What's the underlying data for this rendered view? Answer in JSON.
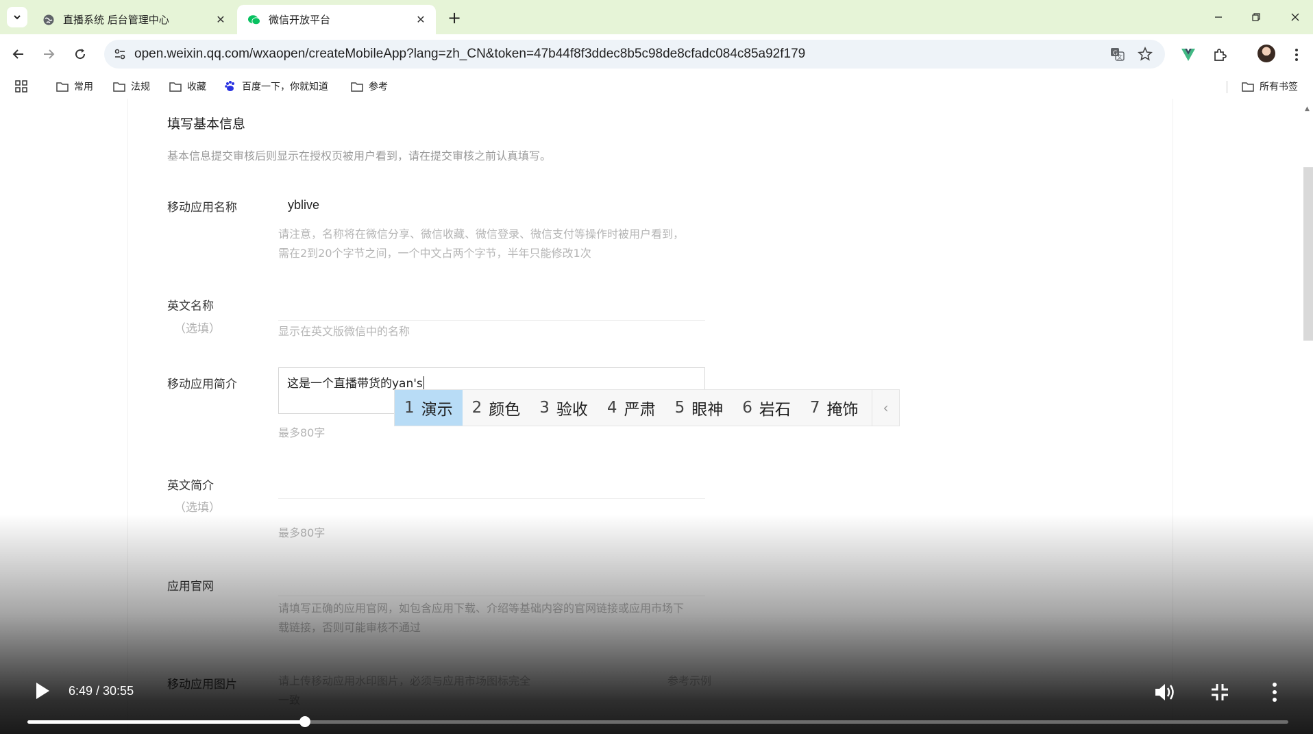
{
  "browser": {
    "tabs": [
      {
        "title": "直播系统 后台管理中心",
        "favicon": "globe-icon"
      },
      {
        "title": "微信开放平台",
        "favicon": "wechat-icon",
        "active": true
      }
    ],
    "url": "open.weixin.qq.com/wxaopen/createMobileApp?lang=zh_CN&token=47b44f8f3ddec8b5c98de8cfadc084c85a92f179",
    "bookmarks": [
      {
        "label": "常用",
        "icon": "folder-icon"
      },
      {
        "label": "法规",
        "icon": "folder-icon"
      },
      {
        "label": "收藏",
        "icon": "folder-icon"
      },
      {
        "label": "百度一下，你就知道",
        "icon": "baidu-paw-icon"
      },
      {
        "label": "参考",
        "icon": "folder-icon"
      }
    ],
    "all_bookmarks": "所有书签"
  },
  "form": {
    "section_title": "填写基本信息",
    "section_desc": "基本信息提交审核后则显示在授权页被用户看到，请在提交审核之前认真填写。",
    "app_name": {
      "label": "移动应用名称",
      "value": "yblive",
      "tip_line1": "请注意，名称将在微信分享、微信收藏、微信登录、微信支付等操作时被用户看到，",
      "tip_line2": "需在2到20个字节之间，一个中文占两个字节，半年只能修改1次"
    },
    "english_name": {
      "label": "英文名称",
      "optional": "（选填）",
      "tip": "显示在英文版微信中的名称"
    },
    "app_intro": {
      "label": "移动应用简介",
      "value": "这是一个直播带货的yan's",
      "tip": "最多80字"
    },
    "english_intro": {
      "label": "英文简介",
      "optional": "（选填）",
      "tip": "最多80字"
    },
    "website": {
      "label": "应用官网",
      "tip_line1": "请填写正确的应用官网，如包含应用下载、介绍等基础内容的官网链接或应用市场下",
      "tip_line2": "载链接，否则可能审核不通过"
    },
    "app_image": {
      "label": "移动应用图片",
      "tip_line1": "请上传移动应用水印图片，必须与应用市场图标完全",
      "tip_line2": "一致",
      "example": "参考示例"
    }
  },
  "ime": {
    "candidates": [
      {
        "num": "1",
        "text": "演示",
        "selected": true
      },
      {
        "num": "2",
        "text": "颜色"
      },
      {
        "num": "3",
        "text": "验收"
      },
      {
        "num": "4",
        "text": "严肃"
      },
      {
        "num": "5",
        "text": "眼神"
      },
      {
        "num": "6",
        "text": "岩石"
      },
      {
        "num": "7",
        "text": "掩饰"
      }
    ]
  },
  "player": {
    "current_time": "6:49",
    "duration": "30:55",
    "time_display": "6:49 / 30:55",
    "progress_fraction": 0.22
  },
  "colors": {
    "tabstrip": "#e6f4d7",
    "ime_selected": "#b8dcf6",
    "wechat_green": "#07c160"
  }
}
